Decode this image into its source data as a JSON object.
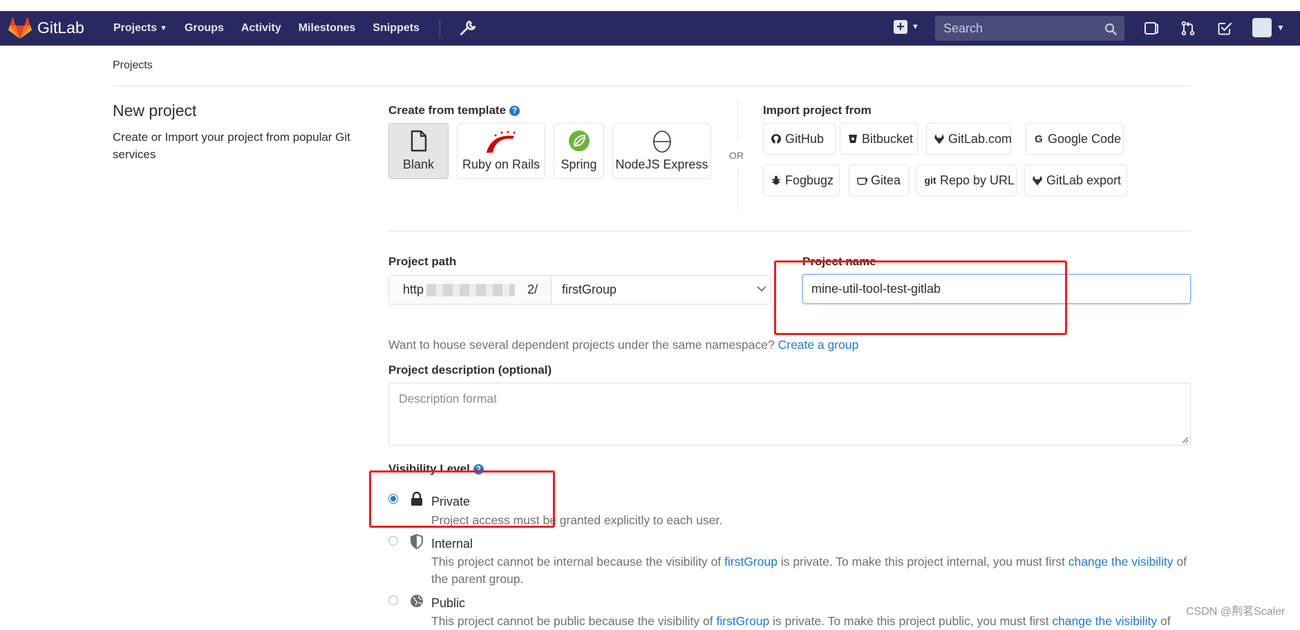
{
  "navbar": {
    "brand": "GitLab",
    "links": [
      "Projects",
      "Groups",
      "Activity",
      "Milestones",
      "Snippets"
    ],
    "search_placeholder": "Search"
  },
  "breadcrumb": "Projects",
  "page": {
    "title": "New project",
    "description": "Create or Import your project from popular Git services"
  },
  "templates": {
    "label": "Create from template",
    "items": [
      "Blank",
      "Ruby on Rails",
      "Spring",
      "NodeJS Express"
    ]
  },
  "or_label": "OR",
  "import": {
    "label": "Import project from",
    "items": [
      "GitHub",
      "Bitbucket",
      "GitLab.com",
      "Google Code",
      "Fogbugz",
      "Gitea",
      "Repo by URL",
      "GitLab export"
    ]
  },
  "form": {
    "path_label": "Project path",
    "path_prefix_start": "http",
    "path_prefix_end": "2/",
    "namespace": "firstGroup",
    "name_label": "Project name",
    "name_value": "mine-util-tool-test-gitlab",
    "hint_text": "Want to house several dependent projects under the same namespace?",
    "hint_link": "Create a group",
    "description_label": "Project description (optional)",
    "description_placeholder": "Description format"
  },
  "visibility": {
    "label": "Visibility Level",
    "options": [
      {
        "title": "Private",
        "checked": true,
        "desc": "Project access must be granted explicitly to each user."
      },
      {
        "title": "Internal",
        "checked": false,
        "desc_a": "This project cannot be internal because the visibility of ",
        "group": "firstGroup",
        "desc_b": " is private. To make this project internal, you must first ",
        "link": "change the visibility",
        "desc_c": " of",
        "desc_d": "the parent group."
      },
      {
        "title": "Public",
        "checked": false,
        "desc_a": "This project cannot be public because the visibility of ",
        "group": "firstGroup",
        "desc_b": " is private. To make this project public, you must first ",
        "link": "change the visibility",
        "desc_c": " of"
      }
    ]
  },
  "colors": {
    "nav_bg": "#292961",
    "link": "#1f78d1",
    "annotation_red": "#ef1c1c"
  },
  "watermark": "CSDN @荆茗Scaler"
}
